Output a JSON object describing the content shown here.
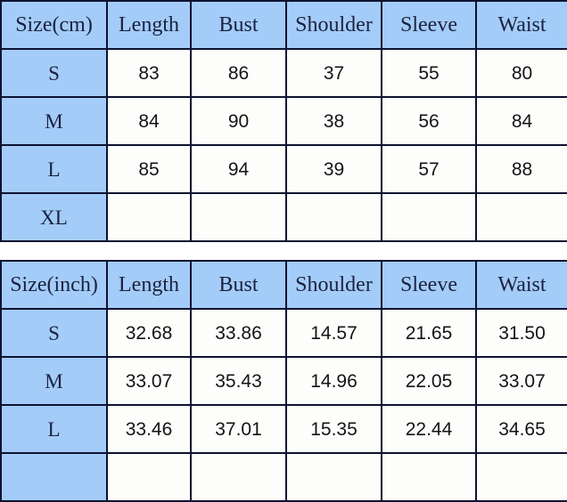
{
  "chart_data": {
    "type": "table",
    "title": "Garment Size Chart",
    "tables": [
      {
        "id": "cm-table",
        "unit": "cm",
        "columns": [
          "Size(cm)",
          "Length",
          "Bust",
          "Shoulder",
          "Sleeve",
          "Waist"
        ],
        "rows": [
          {
            "size": "S",
            "values": [
              "83",
              "86",
              "37",
              "55",
              "80"
            ]
          },
          {
            "size": "M",
            "values": [
              "84",
              "90",
              "38",
              "56",
              "84"
            ]
          },
          {
            "size": "L",
            "values": [
              "85",
              "94",
              "39",
              "57",
              "88"
            ]
          },
          {
            "size": "XL",
            "values": [
              "",
              "",
              "",
              "",
              ""
            ]
          }
        ]
      },
      {
        "id": "inch-table",
        "unit": "inch",
        "columns": [
          "Size(inch)",
          "Length",
          "Bust",
          "Shoulder",
          "Sleeve",
          "Waist"
        ],
        "rows": [
          {
            "size": "S",
            "values": [
              "32.68",
              "33.86",
              "14.57",
              "21.65",
              "31.50"
            ]
          },
          {
            "size": "M",
            "values": [
              "33.07",
              "35.43",
              "14.96",
              "22.05",
              "33.07"
            ]
          },
          {
            "size": "L",
            "values": [
              "33.46",
              "37.01",
              "15.35",
              "22.44",
              "34.65"
            ]
          },
          {
            "size": "",
            "values": [
              "",
              "",
              "",
              "",
              ""
            ]
          }
        ]
      }
    ]
  },
  "tables": [
    {
      "header": {
        "size": "Size(cm)",
        "length": "Length",
        "bust": "Bust",
        "shoulder": "Shoulder",
        "sleeve": "Sleeve",
        "waist": "Waist"
      },
      "rows": [
        {
          "size": "S",
          "length": "83",
          "bust": "86",
          "shoulder": "37",
          "sleeve": "55",
          "waist": "80"
        },
        {
          "size": "M",
          "length": "84",
          "bust": "90",
          "shoulder": "38",
          "sleeve": "56",
          "waist": "84"
        },
        {
          "size": "L",
          "length": "85",
          "bust": "94",
          "shoulder": "39",
          "sleeve": "57",
          "waist": "88"
        },
        {
          "size": "XL",
          "length": "",
          "bust": "",
          "shoulder": "",
          "sleeve": "",
          "waist": ""
        }
      ]
    },
    {
      "header": {
        "size": "Size(inch)",
        "length": "Length",
        "bust": "Bust",
        "shoulder": "Shoulder",
        "sleeve": "Sleeve",
        "waist": "Waist"
      },
      "rows": [
        {
          "size": "S",
          "length": "32.68",
          "bust": "33.86",
          "shoulder": "14.57",
          "sleeve": "21.65",
          "waist": "31.50"
        },
        {
          "size": "M",
          "length": "33.07",
          "bust": "35.43",
          "shoulder": "14.96",
          "sleeve": "22.05",
          "waist": "33.07"
        },
        {
          "size": "L",
          "length": "33.46",
          "bust": "37.01",
          "shoulder": "15.35",
          "sleeve": "22.44",
          "waist": "34.65"
        },
        {
          "size": "",
          "length": "",
          "bust": "",
          "shoulder": "",
          "sleeve": "",
          "waist": ""
        }
      ]
    }
  ],
  "colors": {
    "header_blue": "#a4ccf8",
    "border": "#0d1330",
    "header_text": "#1a2240",
    "cell_background": "#fdfdfb",
    "cell_text": "#141414",
    "page_background": "#ffffff"
  }
}
